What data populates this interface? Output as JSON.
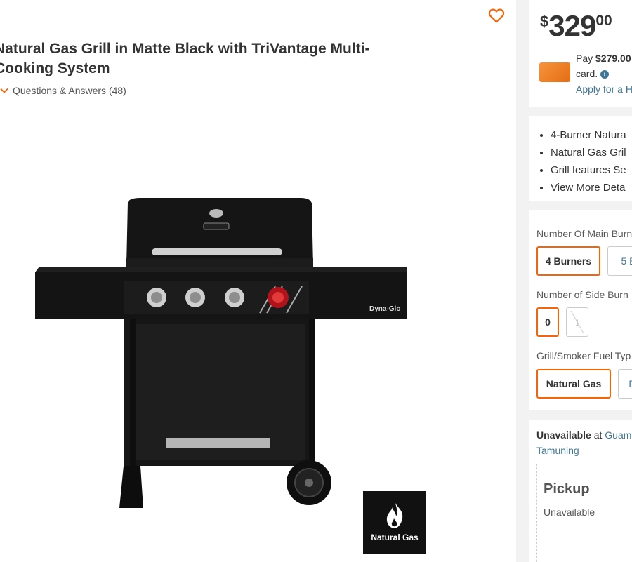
{
  "product": {
    "title_line1": "Natural Gas Grill in Matte Black with TriVantage Multi-",
    "title_line2": "Cooking System",
    "qa_label": "Questions & Answers (48)",
    "brand_text": "Dyna-Glo",
    "badge_label": "Natural Gas"
  },
  "pricing": {
    "currency": "$",
    "dollars": "329",
    "cents": "00",
    "pay_prefix": "Pay ",
    "pay_amount": "$279.00",
    "pay_line2": "card.",
    "apply_link": "Apply for a H"
  },
  "features": [
    "4-Burner Natura",
    "Natural Gas Gril",
    "Grill features Se"
  ],
  "view_more": "View More Deta",
  "options": {
    "main_burners_label": "Number Of Main Burn",
    "main_burners": [
      {
        "label": "4 Burners",
        "selected": true
      },
      {
        "label": "5 B",
        "selected": false
      }
    ],
    "side_burners_label": "Number of Side Burn",
    "side_burners": [
      {
        "label": "0",
        "selected": true
      },
      {
        "label": "1",
        "selected": false,
        "disabled": true
      }
    ],
    "fuel_label": "Grill/Smoker Fuel Typ",
    "fuel": [
      {
        "label": "Natural Gas",
        "selected": true
      },
      {
        "label": "P",
        "selected": false
      }
    ]
  },
  "availability": {
    "status": "Unavailable",
    "at_text": " at ",
    "store": "Guam",
    "store_line2": "Tamuning",
    "pickup_title": "Pickup",
    "pickup_status": "Unavailable"
  },
  "colors": {
    "accent": "#f96302",
    "link": "#3e7697"
  }
}
